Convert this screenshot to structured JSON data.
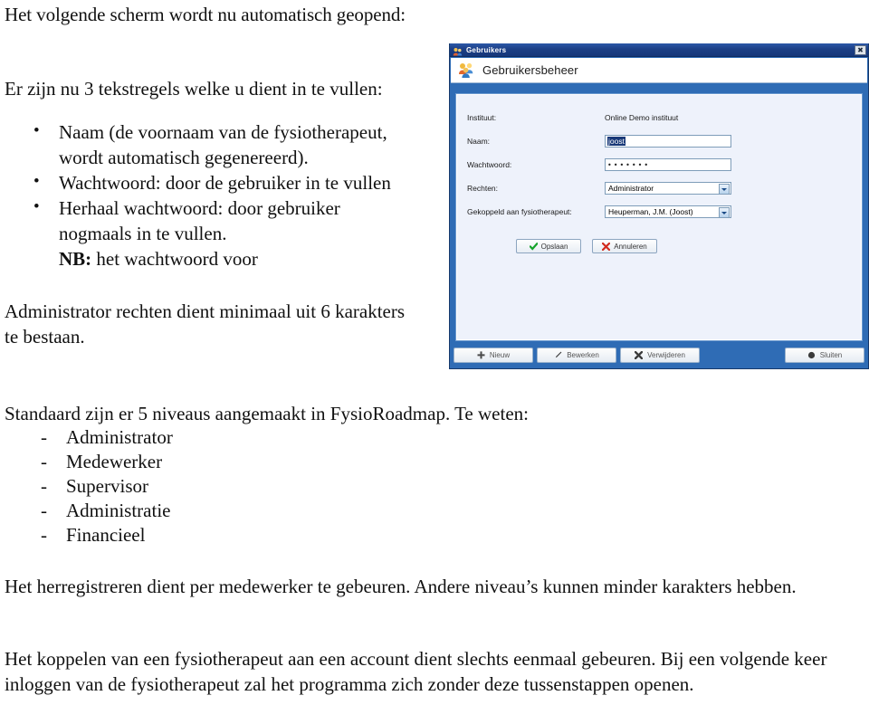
{
  "document": {
    "heading": "Het volgende scherm wordt nu automatisch geopend:",
    "intro": "Er zijn nu 3 tekstregels welke u dient in te vullen:",
    "bullets": [
      "Naam (de voornaam van de fysiotherapeut, wordt automatisch gegenereerd).",
      "Wachtwoord: door de gebruiker in te vullen",
      "Herhaal wachtwoord: door gebruiker nogmaals in te vullen."
    ],
    "nb_label": "NB:",
    "nb_text_inline": "het wachtwoord voor",
    "nb_continuation": "Administrator rechten  dient minimaal uit 6 karakters te bestaan.",
    "levels_intro": "Standaard zijn er  5 niveaus aangemaakt in FysioRoadmap. Te weten:",
    "levels": [
      "Administrator",
      "Medewerker",
      "Supervisor",
      "Administratie",
      "Financieel"
    ],
    "para_herregistreren": "Het herregistreren dient per medewerker te gebeuren. Andere niveau’s kunnen minder karakters hebben.",
    "para_koppelen": "Het koppelen van een fysiotherapeut aan een account dient slechts eenmaal gebeuren. Bij een volgende keer inloggen van de fysiotherapeut zal het programma zich zonder deze tussenstappen openen."
  },
  "screenshot_window": {
    "titlebar": {
      "title": "Gebruikers",
      "icon": "users-icon",
      "close_label": "✖"
    },
    "header": {
      "title": "Gebruikersbeheer",
      "icon": "users-group-icon"
    },
    "form": {
      "fields": [
        {
          "label": "Instituut:",
          "value": "Online Demo instituut",
          "type": "static"
        },
        {
          "label": "Naam:",
          "value": "joost",
          "type": "text",
          "selected": true
        },
        {
          "label": "Wachtwoord:",
          "value": "•••••••",
          "type": "password"
        },
        {
          "label": "Rechten:",
          "value": "Administrator",
          "type": "select"
        },
        {
          "label": "Gekoppeld aan fysiotherapeut:",
          "value": "Heuperman, J.M.  (Joost)",
          "type": "select"
        }
      ],
      "buttons": [
        {
          "label": "Opslaan",
          "icon": "check-icon"
        },
        {
          "label": "Annuleren",
          "icon": "cross-icon"
        }
      ]
    },
    "toolbar": [
      {
        "label": "Nieuw",
        "icon": "plus-icon"
      },
      {
        "label": "Bewerken",
        "icon": "pencil-icon"
      },
      {
        "label": "Verwijderen",
        "icon": "delete-icon"
      },
      {
        "label": "Sluiten",
        "icon": "close-circle-icon"
      }
    ]
  },
  "colors": {
    "window_frame": "#2f6cb5",
    "titlebar": "#1c3f86",
    "panel_bg": "#eef2fb",
    "panel_border": "#6e9bd0",
    "selection": "#183878"
  }
}
